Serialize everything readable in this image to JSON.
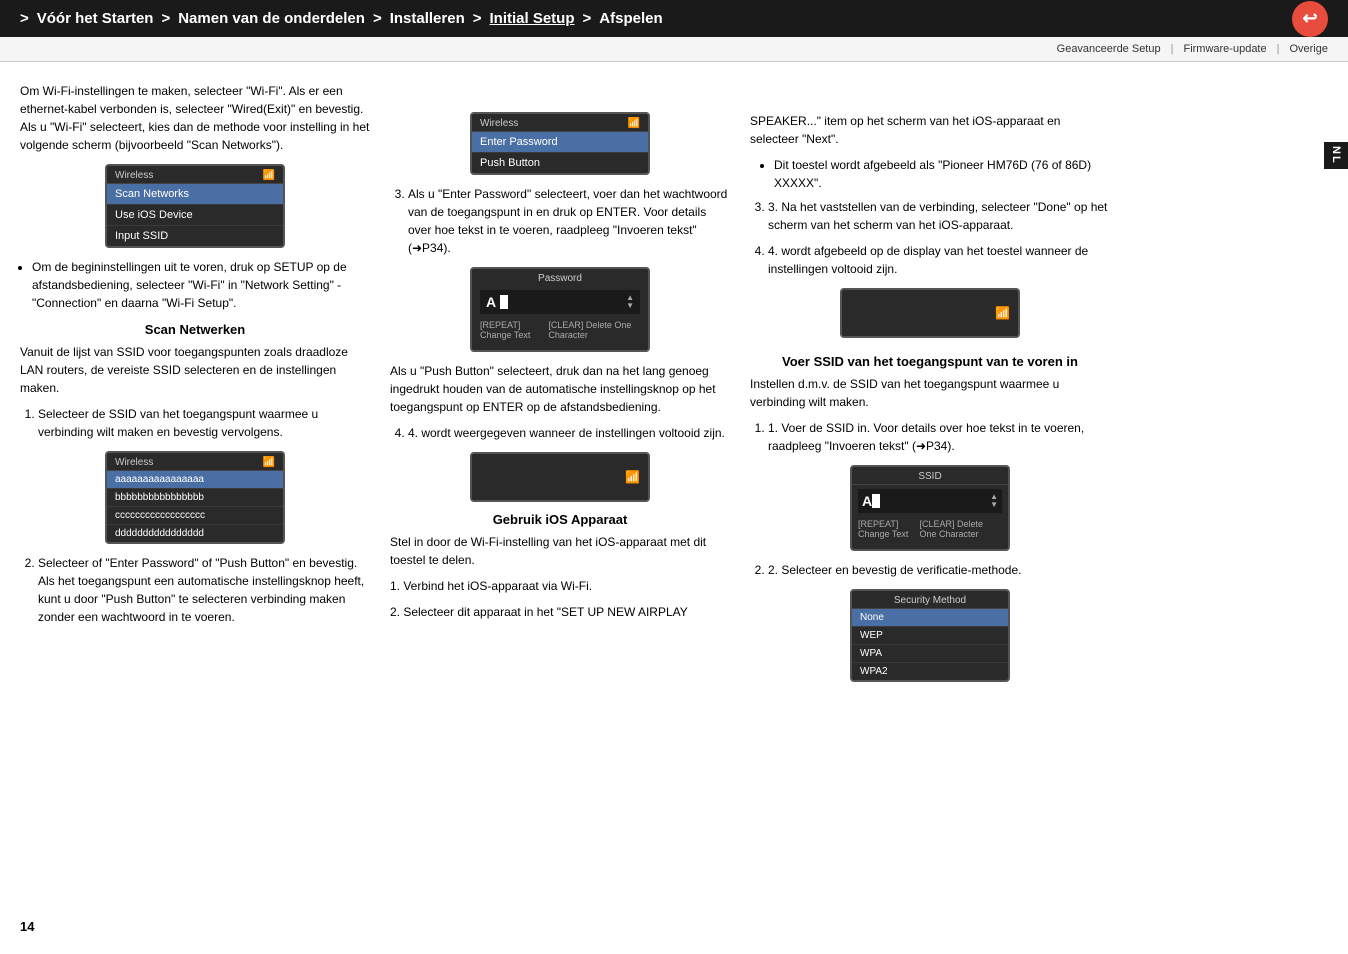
{
  "nav": {
    "items": [
      {
        "label": "Vóór het Starten",
        "active": false
      },
      {
        "label": "Namen van de onderdelen",
        "active": false
      },
      {
        "label": "Installeren",
        "active": false
      },
      {
        "label": "Initial Setup",
        "active": true
      },
      {
        "label": "Afspelen",
        "active": false
      }
    ],
    "separator": ">",
    "back_button": "↩"
  },
  "secondary_nav": {
    "items": [
      "Geavanceerde Setup",
      "Firmware-update",
      "Overige"
    ]
  },
  "nl_badge": "NL",
  "left_col": {
    "intro_text": "Om Wi-Fi-instellingen te maken, selecteer \"Wi-Fi\". Als er een ethernet-kabel verbonden is, selecteer \"Wired(Exit)\" en bevestig. Als u \"Wi-Fi\" selecteert, kies dan de methode voor instelling in het volgende scherm (bijvoorbeeld \"Scan Networks\").",
    "screen1": {
      "wifi_icon": "📶",
      "label": "Wireless",
      "items": [
        {
          "text": "Scan Networks",
          "selected": true
        },
        {
          "text": "Use iOS Device",
          "selected": false
        },
        {
          "text": "Input SSID",
          "selected": false
        }
      ]
    },
    "bullet1": "Om de begininstellingen uit te voren, druk op SETUP op de afstandsbediening, selecteer \"Wi-Fi\" in \"Network Setting\" - \"Connection\" en daarna \"Wi-Fi Setup\".",
    "scan_heading": "Scan Netwerken",
    "scan_text": "Vanuit de lijst van SSID voor toegangspunten zoals draadloze LAN routers, de vereiste SSID selecteren en de instellingen maken.",
    "scan_step1": "Selecteer de SSID van het toegangspunt waarmee u verbinding wilt maken en bevestig vervolgens.",
    "screen2": {
      "wifi_icon": "📶",
      "label": "Wireless",
      "ssid_items": [
        {
          "text": "aaaaaaaaaaaaaaaa",
          "selected": true
        },
        {
          "text": "bbbbbbbbbbbbbbbb",
          "selected": false
        },
        {
          "text": "cccccccccccccccccc",
          "selected": false
        },
        {
          "text": "dddddddddddddddd",
          "selected": false
        }
      ]
    },
    "scan_step2": "Selecteer of \"Enter Password\" of \"Push Button\" en bevestig. Als het toegangspunt een automatische instellingsknop heeft, kunt u door \"Push Button\" te selecteren verbinding maken zonder een wachtwoord in te voeren."
  },
  "middle_col": {
    "screen3": {
      "wifi_icon": "📶",
      "label": "Wireless",
      "items": [
        {
          "text": "Enter Password",
          "selected": true
        },
        {
          "text": "Push Button",
          "selected": false
        }
      ]
    },
    "step3_text": "Als u \"Enter Password\" selecteert, voer dan het wachtwoord van de toegangspunt in en druk op ENTER. Voor details over hoe tekst in te voeren, raadpleeg \"Invoeren tekst\" (➜P34).",
    "screen4": {
      "label": "Password",
      "repeat_label": "[REPEAT]",
      "repeat_action": "Change Text",
      "clear_label": "[CLEAR]",
      "clear_action": "Delete One Character"
    },
    "push_button_text": "Als u \"Push Button\" selecteert, druk dan na het lang genoeg ingedrukt houden van de automatische instellingsknop op het toegangspunt op ENTER op de afstandsbediening.",
    "step4_text": "4.  wordt weergegeven wanneer de instellingen voltooid zijn.",
    "ios_heading": "Gebruik iOS Apparaat",
    "ios_intro": "Stel in door de Wi-Fi-instelling van het iOS-apparaat met dit toestel te delen.",
    "ios_step1": "1. Verbind het iOS-apparaat via Wi-Fi.",
    "ios_step2": "2. Selecteer dit apparaat in het \"SET UP NEW AIRPLAY"
  },
  "right_col": {
    "speaker_text": "SPEAKER...\" item op het scherm van het iOS-apparaat en selecteer \"Next\".",
    "bullet_ios": "Dit toestel wordt afgebeeld als \"Pioneer HM76D (76 of 86D) XXXXX\".",
    "step3_text": "3. Na het vaststellen van de verbinding, selecteer \"Done\" op het scherm van het scherm van het iOS-apparaat.",
    "step4_text": "4.  wordt afgebeeld op de display van het toestel wanneer de instellingen voltooid zijn.",
    "ssid_heading": "Voer SSID van het toegangspunt van te voren in",
    "ssid_intro": "Instellen d.m.v. de SSID van het toegangspunt waarmee u verbinding wilt maken.",
    "ssid_step1": "1. Voer de SSID in. Voor details over hoe tekst in te voeren, raadpleeg \"Invoeren tekst\" (➜P34).",
    "screen_ssid": {
      "label": "SSID",
      "repeat_label": "[REPEAT]",
      "repeat_action": "Change Text",
      "clear_label": "[CLEAR]",
      "clear_action": "Delete One Character"
    },
    "ssid_step2": "2. Selecteer en bevestig de verificatie-methode.",
    "screen_security": {
      "label": "Security Method",
      "items": [
        {
          "text": "None",
          "selected": true
        },
        {
          "text": "WEP",
          "selected": false
        },
        {
          "text": "WPA",
          "selected": false
        },
        {
          "text": "WPA2",
          "selected": false
        }
      ]
    }
  },
  "page_number": "14"
}
